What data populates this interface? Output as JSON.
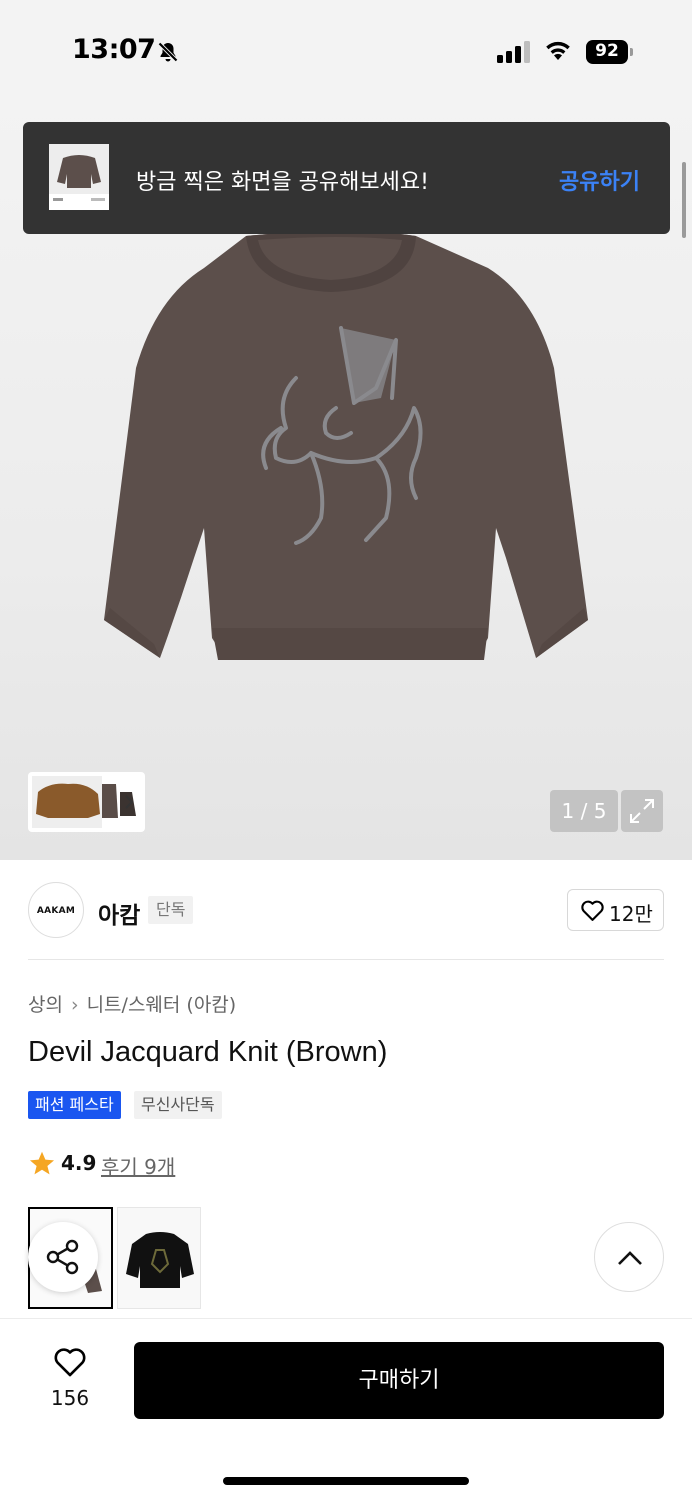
{
  "status_bar": {
    "time": "13:07",
    "battery": "92",
    "icons": [
      "bell-off-icon",
      "signal-icon",
      "wifi-icon",
      "battery-icon"
    ]
  },
  "toast": {
    "message": "방금 찍은 화면을 공유해보세요!",
    "action": "공유하기",
    "action_color": "#3b82f6"
  },
  "gallery": {
    "counter": "1 / 5",
    "product_color": "#5c4f4b",
    "motif_color": "#8a8a8e"
  },
  "brand": {
    "logo_text": "AAKAM",
    "name": "아캄",
    "badge": "단독",
    "likes": "12만"
  },
  "product": {
    "breadcrumb": [
      "상의",
      "니트/스웨터 (아캄)"
    ],
    "title": "Devil Jacquard Knit (Brown)",
    "tags": [
      "패션 페스타",
      "무신사단독"
    ],
    "rating": "4.9",
    "reviews": "후기 9개",
    "accent_blue": "#1a56f0",
    "star_color": "#f5a623"
  },
  "bottom_bar": {
    "wish_count": "156",
    "buy_label": "구매하기"
  }
}
